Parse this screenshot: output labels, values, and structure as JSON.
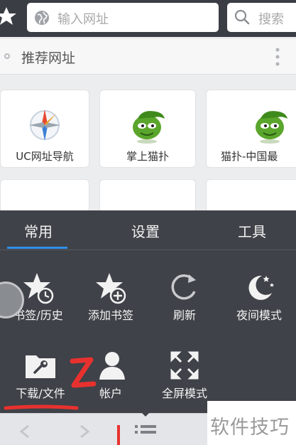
{
  "address_bar": {
    "url_placeholder": "输入网址",
    "search_placeholder": "搜索"
  },
  "recommended": {
    "title": "推荐网址",
    "tiles": [
      {
        "label": "UC网址导航",
        "icon": "compass-icon"
      },
      {
        "label": "掌上猫扑",
        "icon": "mop-mascot-icon"
      },
      {
        "label": "猫扑-中国最",
        "icon": "mop-mascot-icon"
      }
    ]
  },
  "menu": {
    "tabs": [
      {
        "label": "常用",
        "active": true
      },
      {
        "label": "设置",
        "active": false
      },
      {
        "label": "工具",
        "active": false
      }
    ],
    "items": [
      {
        "label": "书签/历史",
        "icon": "bookmark-history-icon"
      },
      {
        "label": "添加书签",
        "icon": "add-bookmark-icon"
      },
      {
        "label": "刷新",
        "icon": "refresh-icon"
      },
      {
        "label": "夜间模式",
        "icon": "night-mode-icon"
      },
      {
        "label": "下载/文件",
        "icon": "download-folder-icon"
      },
      {
        "label": "帐户",
        "icon": "account-icon"
      },
      {
        "label": "全屏模式",
        "icon": "fullscreen-icon"
      }
    ]
  },
  "annotation": {
    "step_number": "2",
    "color": "#e8312f"
  },
  "watermark": "软件技巧",
  "colors": {
    "topbar": "#3a3d44",
    "menu_bg": "#3f4248",
    "tab_indicator": "#2f8fe8"
  }
}
